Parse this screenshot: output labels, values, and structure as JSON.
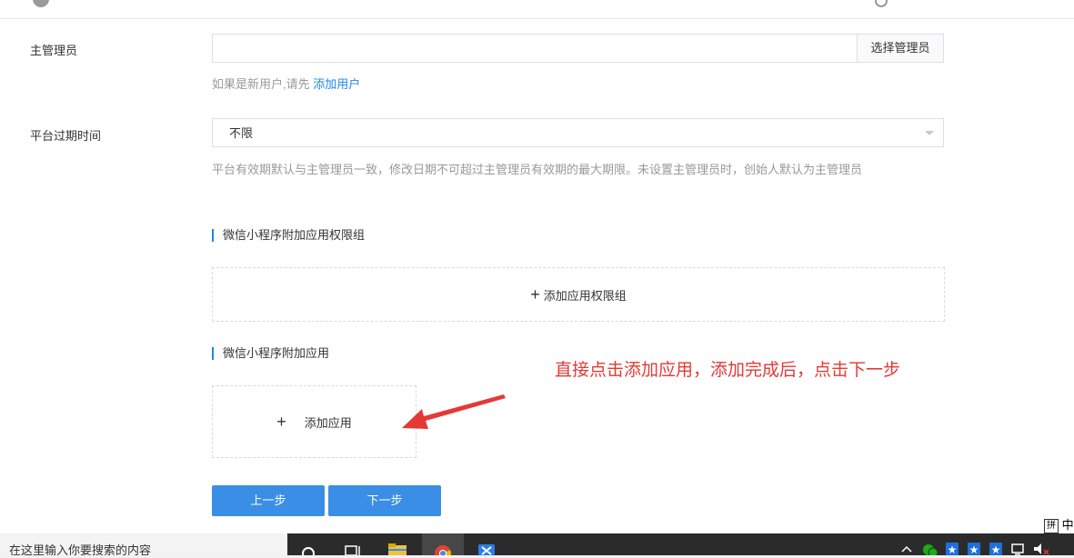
{
  "form": {
    "admin_label": "主管理员",
    "admin_input_value": "",
    "admin_select_button": "选择管理员",
    "admin_hint_prefix": "如果是新用户,请先",
    "admin_hint_link": "添加用户",
    "expire_label": "平台过期时间",
    "expire_value": "不限",
    "expire_hint": "平台有效期默认与主管理员一致，修改日期不可超过主管理员有效期的最大期限。未设置主管理员时，创始人默认为主管理员"
  },
  "sections": {
    "perm_group_title": "微信小程序附加应用权限组",
    "perm_group_add_plus": "+",
    "perm_group_add_label": "添加应用权限组",
    "apps_title": "微信小程序附加应用",
    "apps_add_plus": "+",
    "apps_add_label": "添加应用"
  },
  "annotation": {
    "text": "直接点击添加应用，添加完成后，点击下一步",
    "color": "#e53935"
  },
  "buttons": {
    "prev": "上一步",
    "next": "下一步"
  },
  "ime": {
    "mode_glyph": "拼",
    "lang": "中"
  },
  "taskbar": {
    "search_placeholder": "在这里输入你要搜索的内容",
    "icons": [
      "search-icon",
      "task-view-icon",
      "file-explorer-icon",
      "chrome-icon",
      "app-icon"
    ],
    "tray_icons": [
      "up-arrow-icon",
      "wechat-icon",
      "star-icon",
      "star-icon",
      "star-icon",
      "network-icon",
      "volume-muted-icon"
    ]
  },
  "colors": {
    "primary": "#3a8ee6",
    "link": "#1e88e5",
    "accent_bar": "#1e88e5"
  }
}
